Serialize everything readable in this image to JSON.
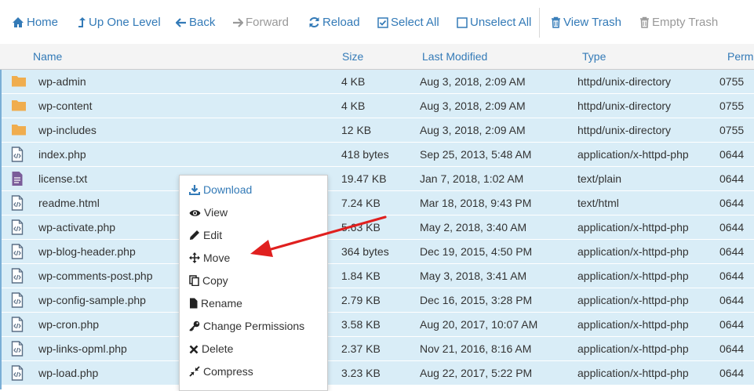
{
  "toolbar": {
    "home": "Home",
    "up": "Up One Level",
    "back": "Back",
    "forward": "Forward",
    "reload": "Reload",
    "select_all": "Select All",
    "unselect_all": "Unselect All",
    "view_trash": "View Trash",
    "empty_trash": "Empty Trash"
  },
  "columns": {
    "name": "Name",
    "size": "Size",
    "modified": "Last Modified",
    "type": "Type",
    "perms": "Perm"
  },
  "files": [
    {
      "name": "wp-admin",
      "size": "4 KB",
      "modified": "Aug 3, 2018, 2:09 AM",
      "type": "httpd/unix-directory",
      "perms": "0755",
      "icon": "folder-icon"
    },
    {
      "name": "wp-content",
      "size": "4 KB",
      "modified": "Aug 3, 2018, 2:09 AM",
      "type": "httpd/unix-directory",
      "perms": "0755",
      "icon": "folder-icon"
    },
    {
      "name": "wp-includes",
      "size": "12 KB",
      "modified": "Aug 3, 2018, 2:09 AM",
      "type": "httpd/unix-directory",
      "perms": "0755",
      "icon": "folder-icon"
    },
    {
      "name": "index.php",
      "size": "418 bytes",
      "modified": "Sep 25, 2013, 5:48 AM",
      "type": "application/x-httpd-php",
      "perms": "0644",
      "icon": "code-file-icon"
    },
    {
      "name": "license.txt",
      "size": "19.47 KB",
      "modified": "Jan 7, 2018, 1:02 AM",
      "type": "text/plain",
      "perms": "0644",
      "icon": "text-file-icon"
    },
    {
      "name": "readme.html",
      "size": "7.24 KB",
      "modified": "Mar 18, 2018, 9:43 PM",
      "type": "text/html",
      "perms": "0644",
      "icon": "code-file-icon"
    },
    {
      "name": "wp-activate.php",
      "size": "5.63 KB",
      "modified": "May 2, 2018, 3:40 AM",
      "type": "application/x-httpd-php",
      "perms": "0644",
      "icon": "code-file-icon"
    },
    {
      "name": "wp-blog-header.php",
      "size": "364 bytes",
      "modified": "Dec 19, 2015, 4:50 PM",
      "type": "application/x-httpd-php",
      "perms": "0644",
      "icon": "code-file-icon"
    },
    {
      "name": "wp-comments-post.php",
      "size": "1.84 KB",
      "modified": "May 3, 2018, 3:41 AM",
      "type": "application/x-httpd-php",
      "perms": "0644",
      "icon": "code-file-icon"
    },
    {
      "name": "wp-config-sample.php",
      "size": "2.79 KB",
      "modified": "Dec 16, 2015, 3:28 PM",
      "type": "application/x-httpd-php",
      "perms": "0644",
      "icon": "code-file-icon"
    },
    {
      "name": "wp-cron.php",
      "size": "3.58 KB",
      "modified": "Aug 20, 2017, 10:07 AM",
      "type": "application/x-httpd-php",
      "perms": "0644",
      "icon": "code-file-icon"
    },
    {
      "name": "wp-links-opml.php",
      "size": "2.37 KB",
      "modified": "Nov 21, 2016, 8:16 AM",
      "type": "application/x-httpd-php",
      "perms": "0644",
      "icon": "code-file-icon"
    },
    {
      "name": "wp-load.php",
      "size": "3.23 KB",
      "modified": "Aug 22, 2017, 5:22 PM",
      "type": "application/x-httpd-php",
      "perms": "0644",
      "icon": "code-file-icon"
    }
  ],
  "context_menu": {
    "download": "Download",
    "view": "View",
    "edit": "Edit",
    "move": "Move",
    "copy": "Copy",
    "rename": "Rename",
    "permissions": "Change Permissions",
    "delete": "Delete",
    "compress": "Compress"
  },
  "colors": {
    "link": "#337ab7",
    "selected_row": "#d9edf7",
    "folder": "#f0ad4e",
    "annotation_arrow": "#e0201f"
  }
}
